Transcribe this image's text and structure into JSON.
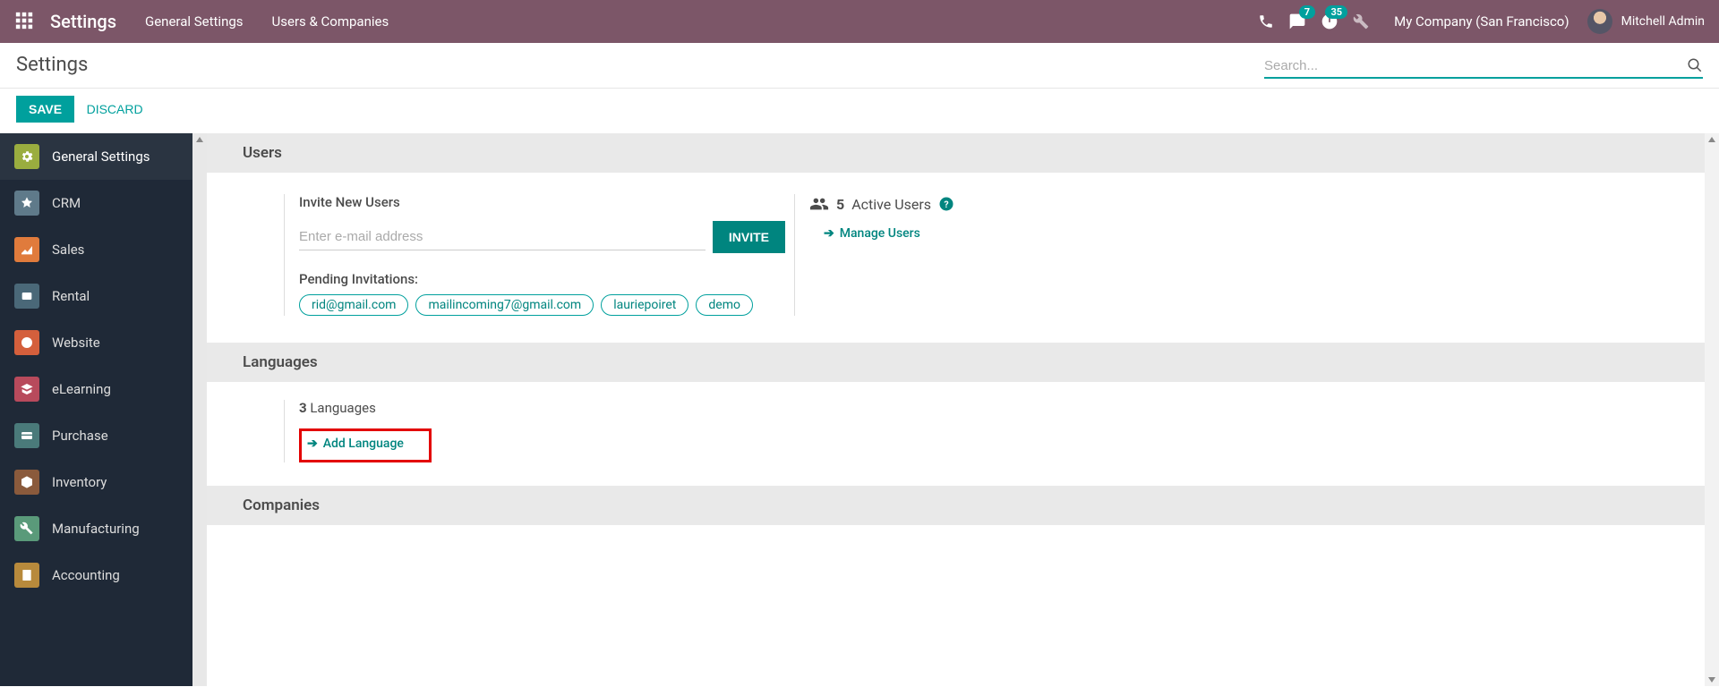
{
  "topnav": {
    "brand": "Settings",
    "menu": [
      "General Settings",
      "Users & Companies"
    ],
    "chat_badge": "7",
    "activity_badge": "35",
    "company": "My Company (San Francisco)",
    "user_name": "Mitchell Admin"
  },
  "control_panel": {
    "title": "Settings",
    "search_placeholder": "Search...",
    "save_label": "SAVE",
    "discard_label": "DISCARD"
  },
  "sidebar": {
    "items": [
      {
        "label": "General Settings"
      },
      {
        "label": "CRM"
      },
      {
        "label": "Sales"
      },
      {
        "label": "Rental"
      },
      {
        "label": "Website"
      },
      {
        "label": "eLearning"
      },
      {
        "label": "Purchase"
      },
      {
        "label": "Inventory"
      },
      {
        "label": "Manufacturing"
      },
      {
        "label": "Accounting"
      }
    ]
  },
  "sections": {
    "users": {
      "title": "Users",
      "invite_label": "Invite New Users",
      "email_placeholder": "Enter e-mail address",
      "invite_btn": "INVITE",
      "pending_label": "Pending Invitations:",
      "pending": [
        "rid@gmail.com",
        "mailincoming7@gmail.com",
        "lauriepoiret",
        "demo"
      ],
      "active_count": "5",
      "active_label": "Active Users",
      "manage_link": "Manage Users"
    },
    "languages": {
      "title": "Languages",
      "count": "3",
      "count_label": "Languages",
      "add_link": "Add Language"
    },
    "companies": {
      "title": "Companies"
    }
  }
}
